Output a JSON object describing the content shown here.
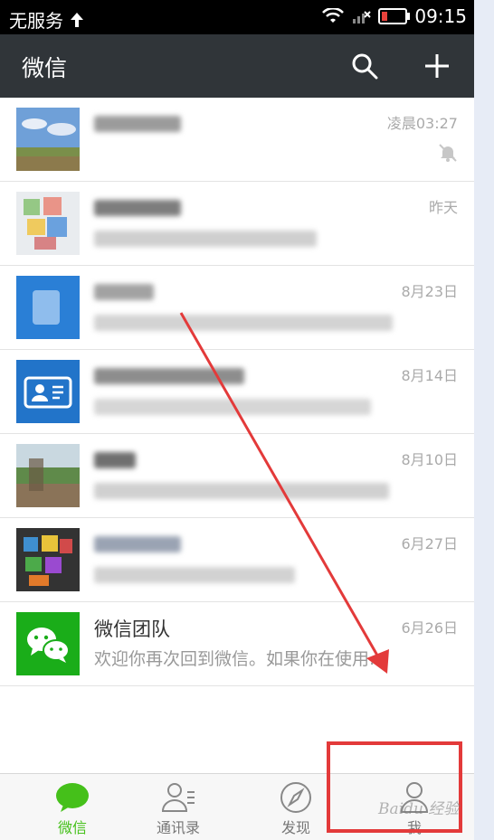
{
  "status_bar": {
    "carrier": "无服务",
    "time": "09:15",
    "colors": {
      "battery_low": "#e8413b"
    }
  },
  "header": {
    "title": "微信",
    "icons": [
      "search-icon",
      "plus-icon"
    ]
  },
  "chats": [
    {
      "name": "",
      "preview": "",
      "time": "凌晨03:27",
      "muted": true
    },
    {
      "name": "",
      "preview": "",
      "time": "昨天"
    },
    {
      "name": "",
      "preview": "",
      "time": "8月23日"
    },
    {
      "name": "",
      "preview": "",
      "time": "8月14日"
    },
    {
      "name": "",
      "preview": "",
      "time": "8月10日"
    },
    {
      "name": "",
      "preview": "",
      "time": "6月27日"
    },
    {
      "name": "微信团队",
      "preview": "欢迎你再次回到微信。如果你在使用…",
      "time": "6月26日"
    }
  ],
  "bottom_nav": {
    "items": [
      {
        "label": "微信",
        "icon": "chat-bubble-icon",
        "active": true
      },
      {
        "label": "通讯录",
        "icon": "contacts-icon"
      },
      {
        "label": "发现",
        "icon": "compass-icon"
      },
      {
        "label": "我",
        "icon": "person-icon"
      }
    ],
    "colors": {
      "active": "#45c01a",
      "inactive": "#777777"
    }
  },
  "colors": {
    "titlebar": "#303539",
    "accent_green": "#45c01a",
    "annotation_red": "#e33a3a"
  },
  "watermark": "Baidu 经验"
}
